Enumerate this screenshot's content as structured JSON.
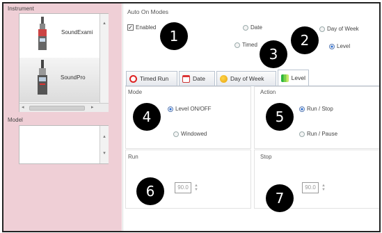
{
  "instrument": {
    "label": "Instrument",
    "items": [
      {
        "name": "SoundExami"
      },
      {
        "name": "SoundPro"
      }
    ]
  },
  "model": {
    "label": "Model"
  },
  "auto_on": {
    "title": "Auto On Modes",
    "enabled_label": "Enabled",
    "enabled_checked": true,
    "options": {
      "date": "Date",
      "timed": "Timed",
      "day_of_week": "Day of Week",
      "level": "Level"
    },
    "selected": "Level"
  },
  "tabs": [
    {
      "label": "Timed Run",
      "active": false
    },
    {
      "label": "Date",
      "active": false
    },
    {
      "label": "Day of Week",
      "active": false
    },
    {
      "label": "Level",
      "active": true
    }
  ],
  "mode": {
    "title": "Mode",
    "options": [
      "Level ON/OFF",
      "Windowed"
    ],
    "selected": "Level ON/OFF"
  },
  "action": {
    "title": "Action",
    "options": [
      "Run / Stop",
      "Run / Pause"
    ],
    "selected": "Run / Stop"
  },
  "run": {
    "title": "Run",
    "value": "90.0"
  },
  "stop": {
    "title": "Stop",
    "value": "90.0"
  },
  "callouts": [
    "1",
    "2",
    "3",
    "4",
    "5",
    "6",
    "7"
  ],
  "colors": {
    "left_panel_bg": "#efcfd6",
    "callout_bg": "#000000",
    "radio_selected": "#2a6fd8"
  }
}
